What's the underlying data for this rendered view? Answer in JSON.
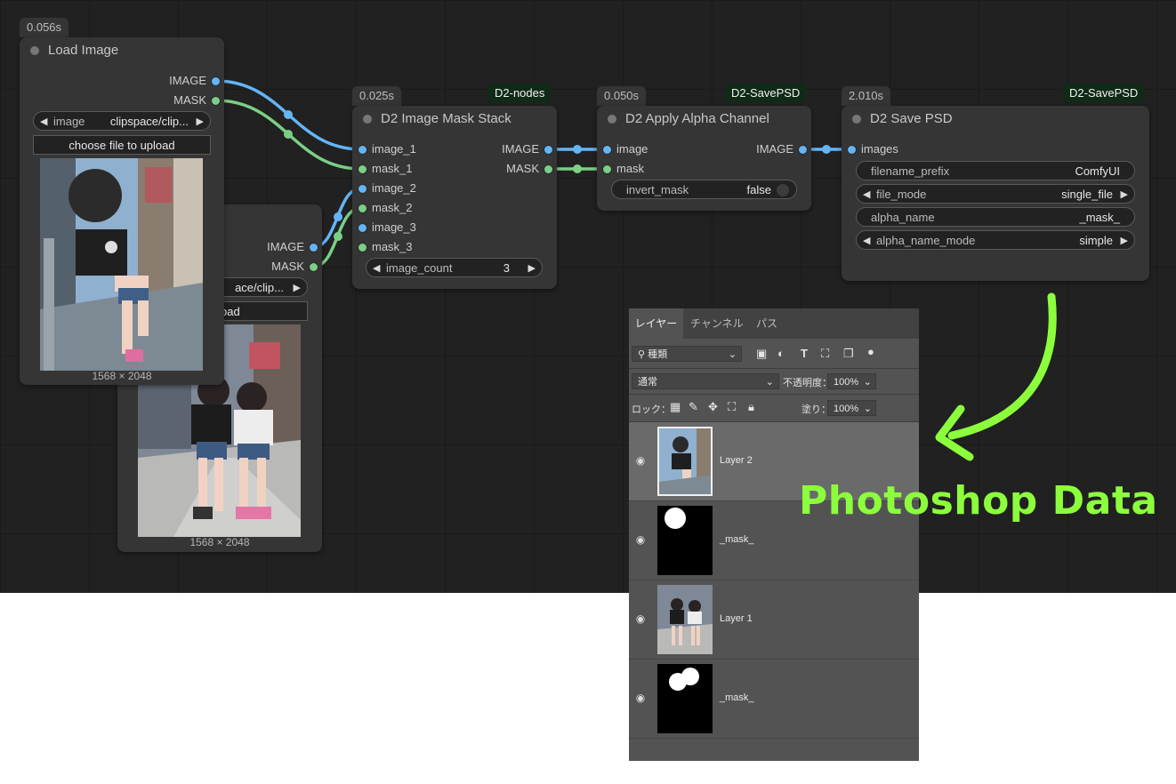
{
  "colors": {
    "canvas": "#212121",
    "node": "#353535",
    "image_wire": "#64b5f6",
    "mask_wire": "#7ccf86",
    "badge_bg": "#0f2a16",
    "arrow": "#8cff3c"
  },
  "load_image_front": {
    "timing": "0.056s",
    "title": "Load Image",
    "outputs": [
      "IMAGE",
      "MASK"
    ],
    "image_widget_label": "image",
    "image_widget_value": "clipspace/clip...",
    "upload_label": "choose file to upload",
    "dimensions": "1568 × 2048"
  },
  "load_image_back": {
    "outputs": [
      "IMAGE",
      "MASK"
    ],
    "image_widget_value": "ace/clip...",
    "upload_label": "to upload",
    "dimensions": "1568 × 2048"
  },
  "mask_stack": {
    "timing": "0.025s",
    "badge": "D2-nodes",
    "title": "D2 Image Mask Stack",
    "inputs": [
      "image_1",
      "mask_1",
      "image_2",
      "mask_2",
      "image_3",
      "mask_3"
    ],
    "outputs": [
      "IMAGE",
      "MASK"
    ],
    "count_label": "image_count",
    "count_value": "3"
  },
  "alpha_channel": {
    "timing": "0.050s",
    "badge": "D2-SavePSD",
    "title": "D2 Apply Alpha Channel",
    "inputs": [
      "image",
      "mask"
    ],
    "outputs": [
      "IMAGE"
    ],
    "invert_label": "invert_mask",
    "invert_value": "false"
  },
  "save_psd": {
    "timing": "2.010s",
    "badge": "D2-SavePSD",
    "title": "D2 Save PSD",
    "inputs": [
      "images"
    ],
    "widgets": [
      {
        "label": "filename_prefix",
        "value": "ComfyUI"
      },
      {
        "label": "file_mode",
        "value": "single_file"
      },
      {
        "label": "alpha_name",
        "value": "_mask_"
      },
      {
        "label": "alpha_name_mode",
        "value": "simple"
      }
    ]
  },
  "photoshop": {
    "tabs": [
      "レイヤー",
      "チャンネル",
      "パス"
    ],
    "filter_label": "種類",
    "blend_mode": "通常",
    "opacity_label": "不透明度：",
    "opacity_value": "100%",
    "lock_label": "ロック：",
    "fill_label": "塗り：",
    "fill_value": "100%",
    "layers": [
      {
        "name": "Layer 2",
        "icon": "eye-icon"
      },
      {
        "name": "_mask_",
        "icon": "eye-icon"
      },
      {
        "name": "Layer 1",
        "icon": "eye-icon"
      },
      {
        "name": "_mask_",
        "icon": "eye-icon"
      }
    ]
  },
  "annotation": {
    "label": "Photoshop Data"
  }
}
